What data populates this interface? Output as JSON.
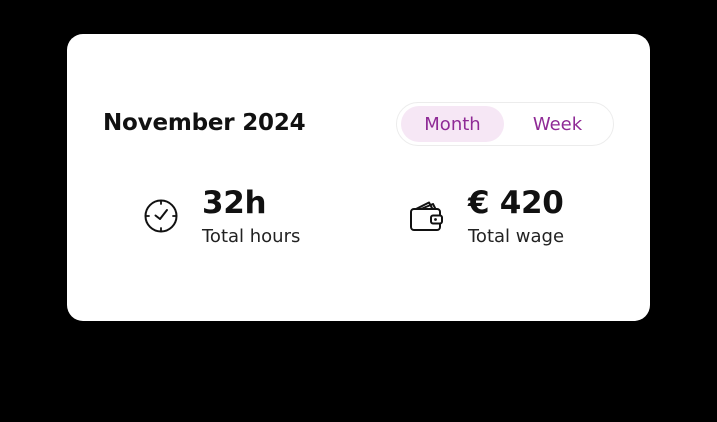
{
  "card": {
    "title": "November 2024"
  },
  "toggle": {
    "options": [
      {
        "label": "Month",
        "selected": true
      },
      {
        "label": "Week",
        "selected": false
      }
    ],
    "accent_color": "#8f2a96",
    "selected_bg": "#f6e7f5"
  },
  "stats": {
    "hours": {
      "icon": "clock-icon",
      "value": "32h",
      "label": "Total hours"
    },
    "wage": {
      "icon": "wallet-icon",
      "value": "€ 420",
      "label": "Total wage"
    }
  }
}
